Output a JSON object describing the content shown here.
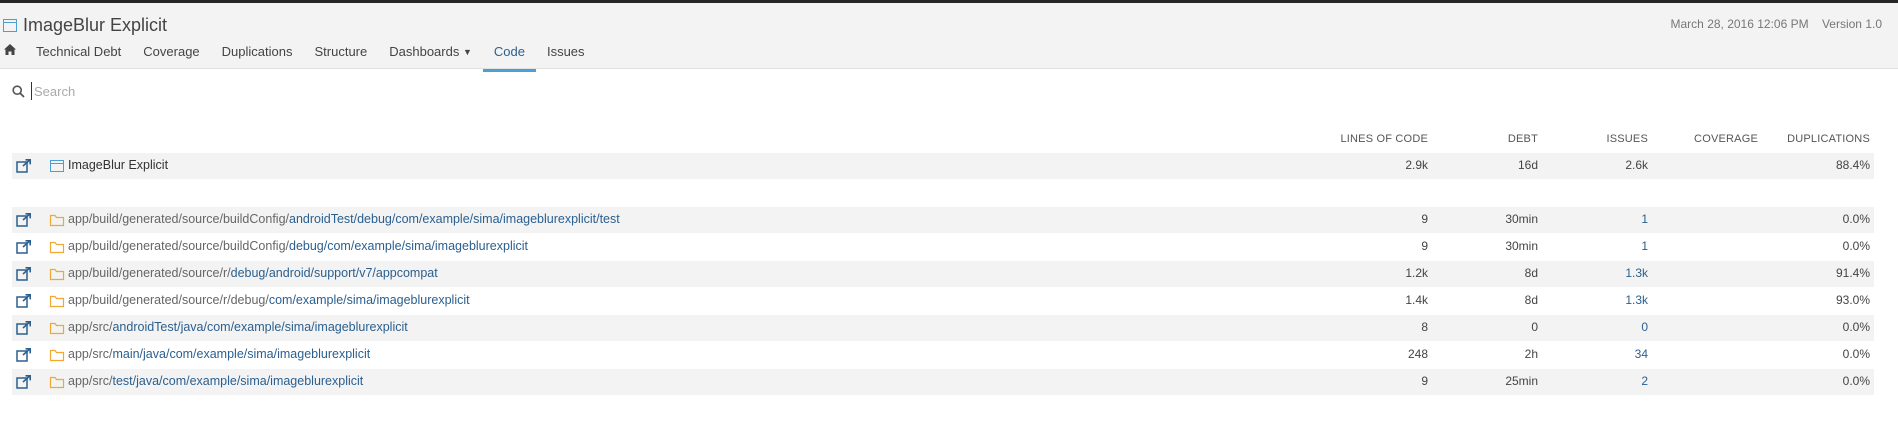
{
  "header": {
    "project_title": "ImageBlur Explicit",
    "date": "March 28, 2016 12:06 PM",
    "version": "Version 1.0"
  },
  "nav": {
    "items": [
      "Technical Debt",
      "Coverage",
      "Duplications",
      "Structure",
      "Dashboards",
      "Code",
      "Issues"
    ],
    "active": "Code"
  },
  "search": {
    "placeholder": "Search"
  },
  "table": {
    "columns": [
      "LINES OF CODE",
      "DEBT",
      "ISSUES",
      "COVERAGE",
      "DUPLICATIONS"
    ],
    "root": {
      "name": "ImageBlur Explicit",
      "loc": "2.9k",
      "debt": "16d",
      "issues": "2.6k",
      "coverage": "",
      "duplications": "88.4%"
    },
    "rows": [
      {
        "dim": "app/build/generated/source/buildConfig/",
        "link": "androidTest/debug/com/example/sima/imageblurexplicit/test",
        "loc": "9",
        "debt": "30min",
        "issues": "1",
        "coverage": "",
        "duplications": "0.0%"
      },
      {
        "dim": "app/build/generated/source/buildConfig/",
        "link": "debug/com/example/sima/imageblurexplicit",
        "loc": "9",
        "debt": "30min",
        "issues": "1",
        "coverage": "",
        "duplications": "0.0%"
      },
      {
        "dim": "app/build/generated/source/r/",
        "link": "debug/android/support/v7/appcompat",
        "loc": "1.2k",
        "debt": "8d",
        "issues": "1.3k",
        "coverage": "",
        "duplications": "91.4%"
      },
      {
        "dim": "app/build/generated/source/r/debug/",
        "link": "com/example/sima/imageblurexplicit",
        "loc": "1.4k",
        "debt": "8d",
        "issues": "1.3k",
        "coverage": "",
        "duplications": "93.0%"
      },
      {
        "dim": "app/src/",
        "link": "androidTest/java/com/example/sima/imageblurexplicit",
        "loc": "8",
        "debt": "0",
        "issues": "0",
        "coverage": "",
        "duplications": "0.0%"
      },
      {
        "dim": "app/src/",
        "link": "main/java/com/example/sima/imageblurexplicit",
        "loc": "248",
        "debt": "2h",
        "issues": "34",
        "coverage": "",
        "duplications": "0.0%"
      },
      {
        "dim": "app/src/",
        "link": "test/java/com/example/sima/imageblurexplicit",
        "loc": "9",
        "debt": "25min",
        "issues": "2",
        "coverage": "",
        "duplications": "0.0%"
      }
    ]
  },
  "colors": {
    "link": "#2b5f8f",
    "active_tab": "#4b9fd5",
    "folder": "#f0a830",
    "row_alt": "#f3f3f3"
  }
}
